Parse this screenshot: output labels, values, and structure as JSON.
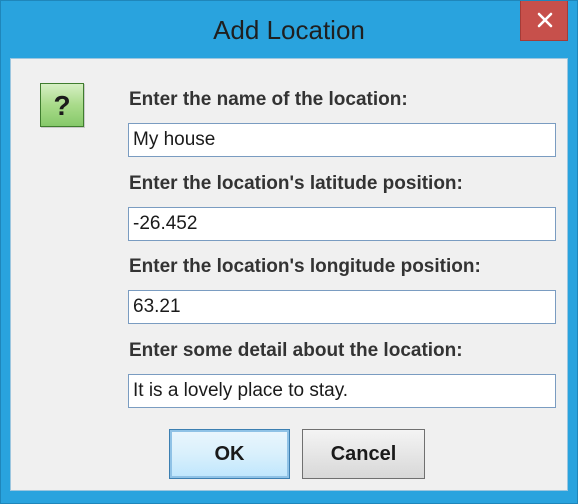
{
  "window": {
    "title": "Add Location",
    "close_label": "✕"
  },
  "dialog": {
    "icon": "question-icon",
    "icon_glyph": "?",
    "fields": [
      {
        "label": "Enter the name of the location:",
        "value": "My house"
      },
      {
        "label": "Enter the location's latitude position:",
        "value": "-26.452"
      },
      {
        "label": "Enter the location's longitude position:",
        "value": "63.21"
      },
      {
        "label": "Enter some detail about the location:",
        "value": "It is a lovely place to stay."
      }
    ]
  },
  "buttons": {
    "ok_label": "OK",
    "cancel_label": "Cancel"
  },
  "colors": {
    "titlebar": "#29a3de",
    "close": "#c7504b",
    "client_bg": "#f0f0f0",
    "icon_green": "#a9db8a"
  }
}
